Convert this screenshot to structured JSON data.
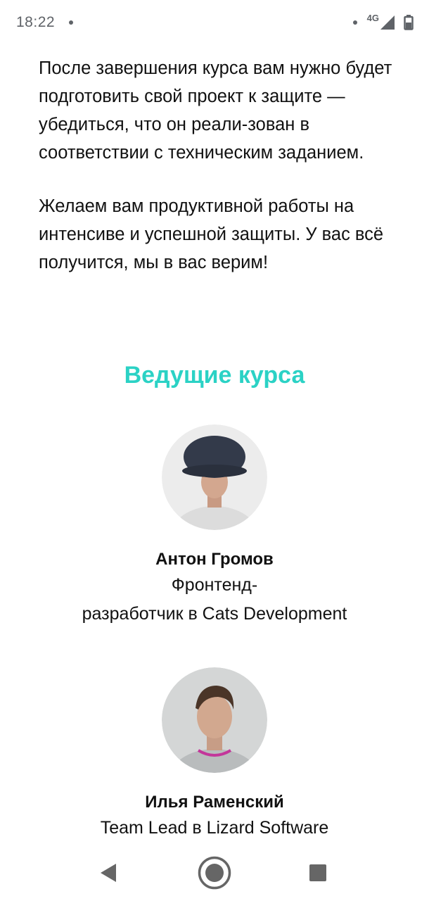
{
  "status_bar": {
    "time": "18:22",
    "network": "4G",
    "icons": [
      "notification-dot-icon",
      "signal-icon",
      "battery-icon"
    ]
  },
  "content": {
    "paragraphs": [
      "После завершения курса вам нужно будет подготовить свой проект к защите — убедиться, что он реали-зован в соответствии с техническим заданием.",
      "Желаем вам продуктивной работы на интенсиве и успешной защиты. У вас всё получится, мы в вас верим!"
    ]
  },
  "section": {
    "title": "Ведущие курса",
    "title_color": "#2bd2c5"
  },
  "hosts": [
    {
      "name": "Антон Громов",
      "role_lines": [
        "Фронтенд-",
        "разработчик в Cats Development"
      ]
    },
    {
      "name": "Илья Раменский",
      "role_lines": [
        "Team Lead в Lizard Software"
      ]
    }
  ],
  "nav_bar": {
    "icons": [
      "back-icon",
      "home-icon",
      "recents-icon"
    ]
  }
}
